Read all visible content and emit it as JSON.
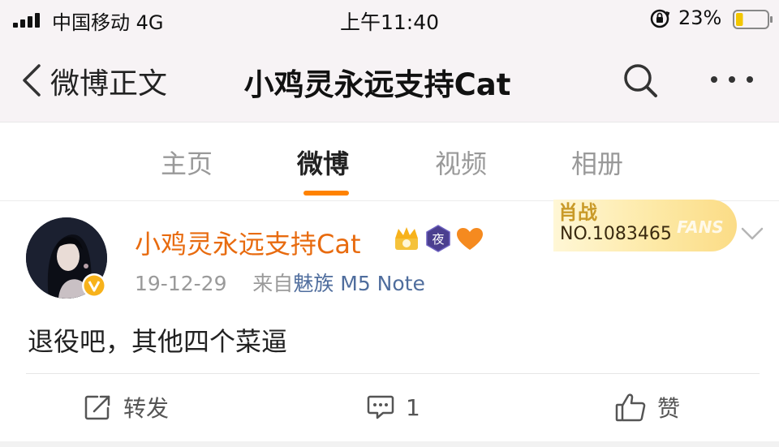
{
  "status_bar": {
    "carrier": "中国移动 4G",
    "time": "上午11:40",
    "battery_percent": "23%",
    "battery_level": 0.23,
    "icons": [
      "signal-icon",
      "orientation-lock-icon",
      "battery-icon"
    ]
  },
  "nav": {
    "back_label": "微博正文",
    "title": "小鸡灵永远支持Cat",
    "icons": [
      "back-chevron-icon",
      "search-icon",
      "more-icon"
    ]
  },
  "tabs": [
    {
      "label": "主页",
      "active": false
    },
    {
      "label": "微博",
      "active": true
    },
    {
      "label": "视频",
      "active": false
    },
    {
      "label": "相册",
      "active": false
    }
  ],
  "post": {
    "author": "小鸡灵永远支持Cat",
    "badge_night_text": "夜",
    "date": "19-12-29",
    "source_prefix": "来自",
    "source": "魅族 M5 Note",
    "fans_card": {
      "name": "肖战",
      "number": "NO.1083465",
      "watermark": "FANS"
    },
    "text": "退役吧，其他四个菜逼",
    "actions": {
      "repost_label": "转发",
      "comment_count": "1",
      "like_label": "赞"
    }
  },
  "colors": {
    "accent_orange": "#ff8200",
    "author_name": "#e86b0f",
    "source_link": "#4f6d9d",
    "header_bg": "#f7f3f5"
  }
}
